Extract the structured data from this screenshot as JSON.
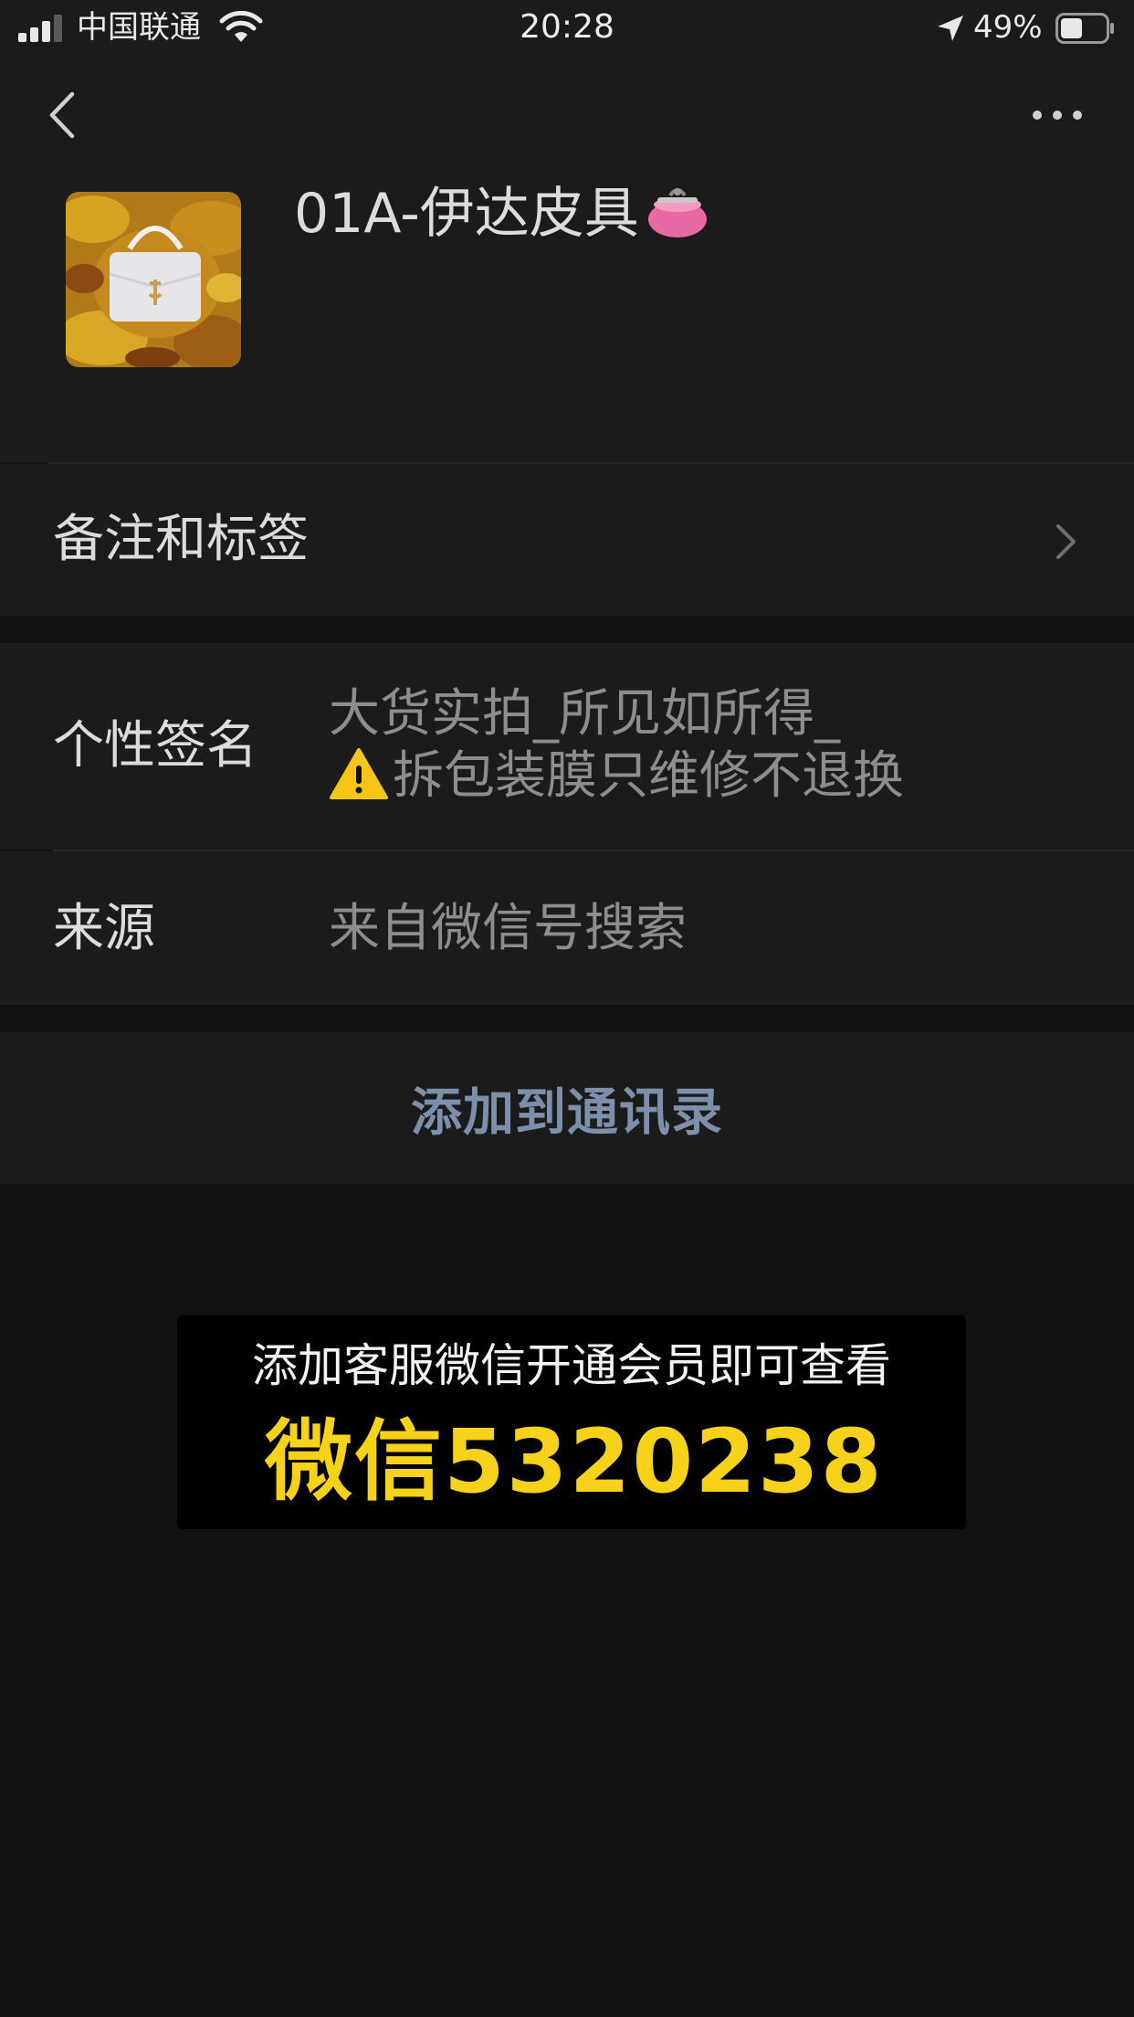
{
  "status_bar": {
    "carrier": "中国联通",
    "time": "20:28",
    "battery_percent": "49%",
    "battery_level": 0.49,
    "icons": [
      "signal-icon",
      "wifi-icon",
      "location-arrow-icon",
      "battery-icon"
    ]
  },
  "nav": {
    "back_icon": "chevron-left-icon",
    "more_icon": "more-dots-icon"
  },
  "profile": {
    "name": "01A-伊达皮具",
    "name_emoji": "purse-icon",
    "avatar_icon": "avatar-bag-photo"
  },
  "remark_row": {
    "label": "备注和标签",
    "icon": "chevron-right-icon"
  },
  "signature_row": {
    "label": "个性签名",
    "line1": "大货实拍_所见如所得_",
    "line2": "拆包装膜只维修不退换",
    "line2_icon": "warning-icon"
  },
  "source_row": {
    "label": "来源",
    "value": "来自微信号搜索"
  },
  "actions": {
    "add_to_contacts": "添加到通讯录"
  },
  "promo": {
    "line1": "添加客服微信开通会员即可查看",
    "line2": "微信5320238"
  },
  "colors": {
    "background": "#111111",
    "cell_background": "#1b1b1b",
    "primary_text": "#dcdcdc",
    "secondary_text": "#8d8d8d",
    "link_text": "#7d90ab",
    "promo_yellow": "#f7d21a"
  }
}
